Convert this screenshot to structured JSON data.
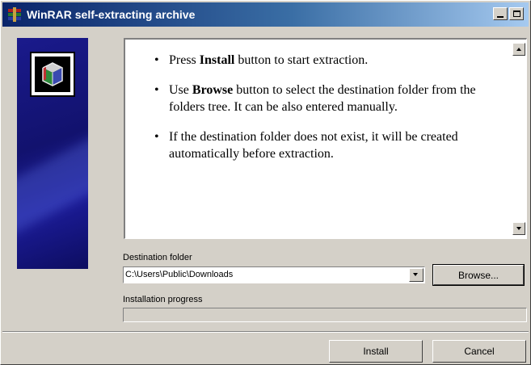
{
  "window": {
    "title": "WinRAR self-extracting archive",
    "icon": "winrar-books-icon",
    "title_gradient": [
      "#0a246a",
      "#a6caf0"
    ]
  },
  "titlebar_buttons": {
    "minimize_icon": "minimize-icon",
    "maximize_icon": "maximize-icon"
  },
  "info": {
    "items": [
      {
        "pre": "Press ",
        "bold": "Install",
        "post": " button to start extraction."
      },
      {
        "pre": "Use ",
        "bold": "Browse",
        "post": " button to select the destination folder from the folders tree. It can be also entered manually."
      },
      {
        "pre": "",
        "bold": "",
        "post": "If the destination folder does not exist, it will be created automatically before extraction."
      }
    ]
  },
  "destination": {
    "label": "Destination folder",
    "value": "C:\\Users\\Public\\Downloads",
    "browse_label": "Browse..."
  },
  "progress": {
    "label": "Installation progress",
    "value": 0
  },
  "footer": {
    "install_label": "Install",
    "cancel_label": "Cancel"
  },
  "colors": {
    "window_bg": "#d4d0c8",
    "banner": "#1a1a8c"
  }
}
